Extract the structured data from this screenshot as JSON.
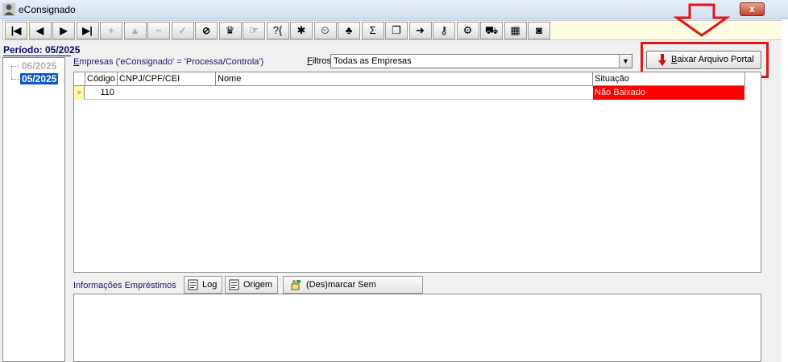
{
  "window": {
    "title": "eConsignado",
    "close_glyph": "x"
  },
  "toolbar": {
    "buttons": [
      {
        "name": "first-record-button",
        "glyph": "|◀"
      },
      {
        "name": "prev-record-button",
        "glyph": "◀"
      },
      {
        "name": "next-record-button",
        "glyph": "▶"
      },
      {
        "name": "last-record-button",
        "glyph": "▶|"
      },
      {
        "name": "insert-record-button",
        "glyph": "+"
      },
      {
        "name": "edit-record-button",
        "glyph": "▲"
      },
      {
        "name": "delete-record-button",
        "glyph": "−"
      },
      {
        "name": "post-record-button",
        "glyph": "✓"
      },
      {
        "name": "cancel-record-button",
        "glyph": "⊘"
      },
      {
        "name": "tool-stamp-button",
        "glyph": "♛"
      },
      {
        "name": "tool-pointer-button",
        "glyph": "☞"
      },
      {
        "name": "tool-question-button",
        "glyph": "?{"
      },
      {
        "name": "tool-network-button",
        "glyph": "✱"
      },
      {
        "name": "tool-clock-button",
        "glyph": "⏲"
      },
      {
        "name": "tool-people-button",
        "glyph": "♣"
      },
      {
        "name": "tool-sum-button",
        "glyph": "Σ"
      },
      {
        "name": "tool-copy-button",
        "glyph": "❐"
      },
      {
        "name": "tool-export-button",
        "glyph": "➜"
      },
      {
        "name": "tool-key-button",
        "glyph": "⚷"
      },
      {
        "name": "tool-gear-button",
        "glyph": "⚙"
      },
      {
        "name": "tool-truck-button",
        "glyph": "⛟"
      },
      {
        "name": "tool-calendar-button",
        "glyph": "▦"
      },
      {
        "name": "tool-stop-button",
        "glyph": "◙"
      }
    ]
  },
  "periodo": {
    "label": "Período: 05/2025",
    "tree": [
      "06/2025",
      "05/2025"
    ]
  },
  "empresas": {
    "label_prefix": "E",
    "label_rest": "mpresas ('eConsignado' = 'Processa/Controla')",
    "filtros_prefix": "F",
    "filtros_rest": "iltros",
    "filtros_value": "Todas as Empresas"
  },
  "baixar_button": {
    "prefix": "B",
    "rest": "aixar Arquivo Portal"
  },
  "grid": {
    "columns": [
      "Código",
      "CNPJ/CPF/CEI",
      "Nome",
      "Situação"
    ],
    "rows": [
      {
        "codigo": "110",
        "cnpj": "",
        "nome": "",
        "situacao": "Não Baixado"
      }
    ]
  },
  "lower": {
    "label": "Informações Empréstimos",
    "log_label": "Log",
    "origem_label": "Origem",
    "desmarcar_label": "(Des)marcar Sem Movimento"
  },
  "colors": {
    "status_red": "#ff0000",
    "highlight_red": "#e11616",
    "toolbar_bg": "#fffde1",
    "selection_blue": "#0a58c8"
  }
}
